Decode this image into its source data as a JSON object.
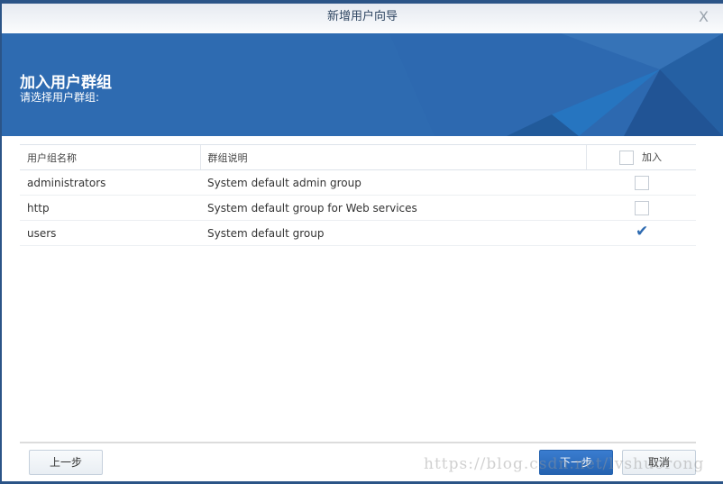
{
  "window": {
    "title": "新增用户向导",
    "close": "X"
  },
  "banner": {
    "title": "加入用户群组",
    "subtitle": "请选择用户群组:"
  },
  "table": {
    "headers": [
      "用户组名称",
      "群组说明",
      "加入"
    ],
    "rows": [
      {
        "name": "administrators",
        "desc": "System default admin group",
        "checked": false
      },
      {
        "name": "http",
        "desc": "System default group for Web services",
        "checked": false
      },
      {
        "name": "users",
        "desc": "System default group",
        "checked": true
      }
    ]
  },
  "buttons": {
    "back": "上一步",
    "next": "下一步",
    "cancel": "取消"
  },
  "watermark": "https://blog.csdn.net/lvshuorong"
}
